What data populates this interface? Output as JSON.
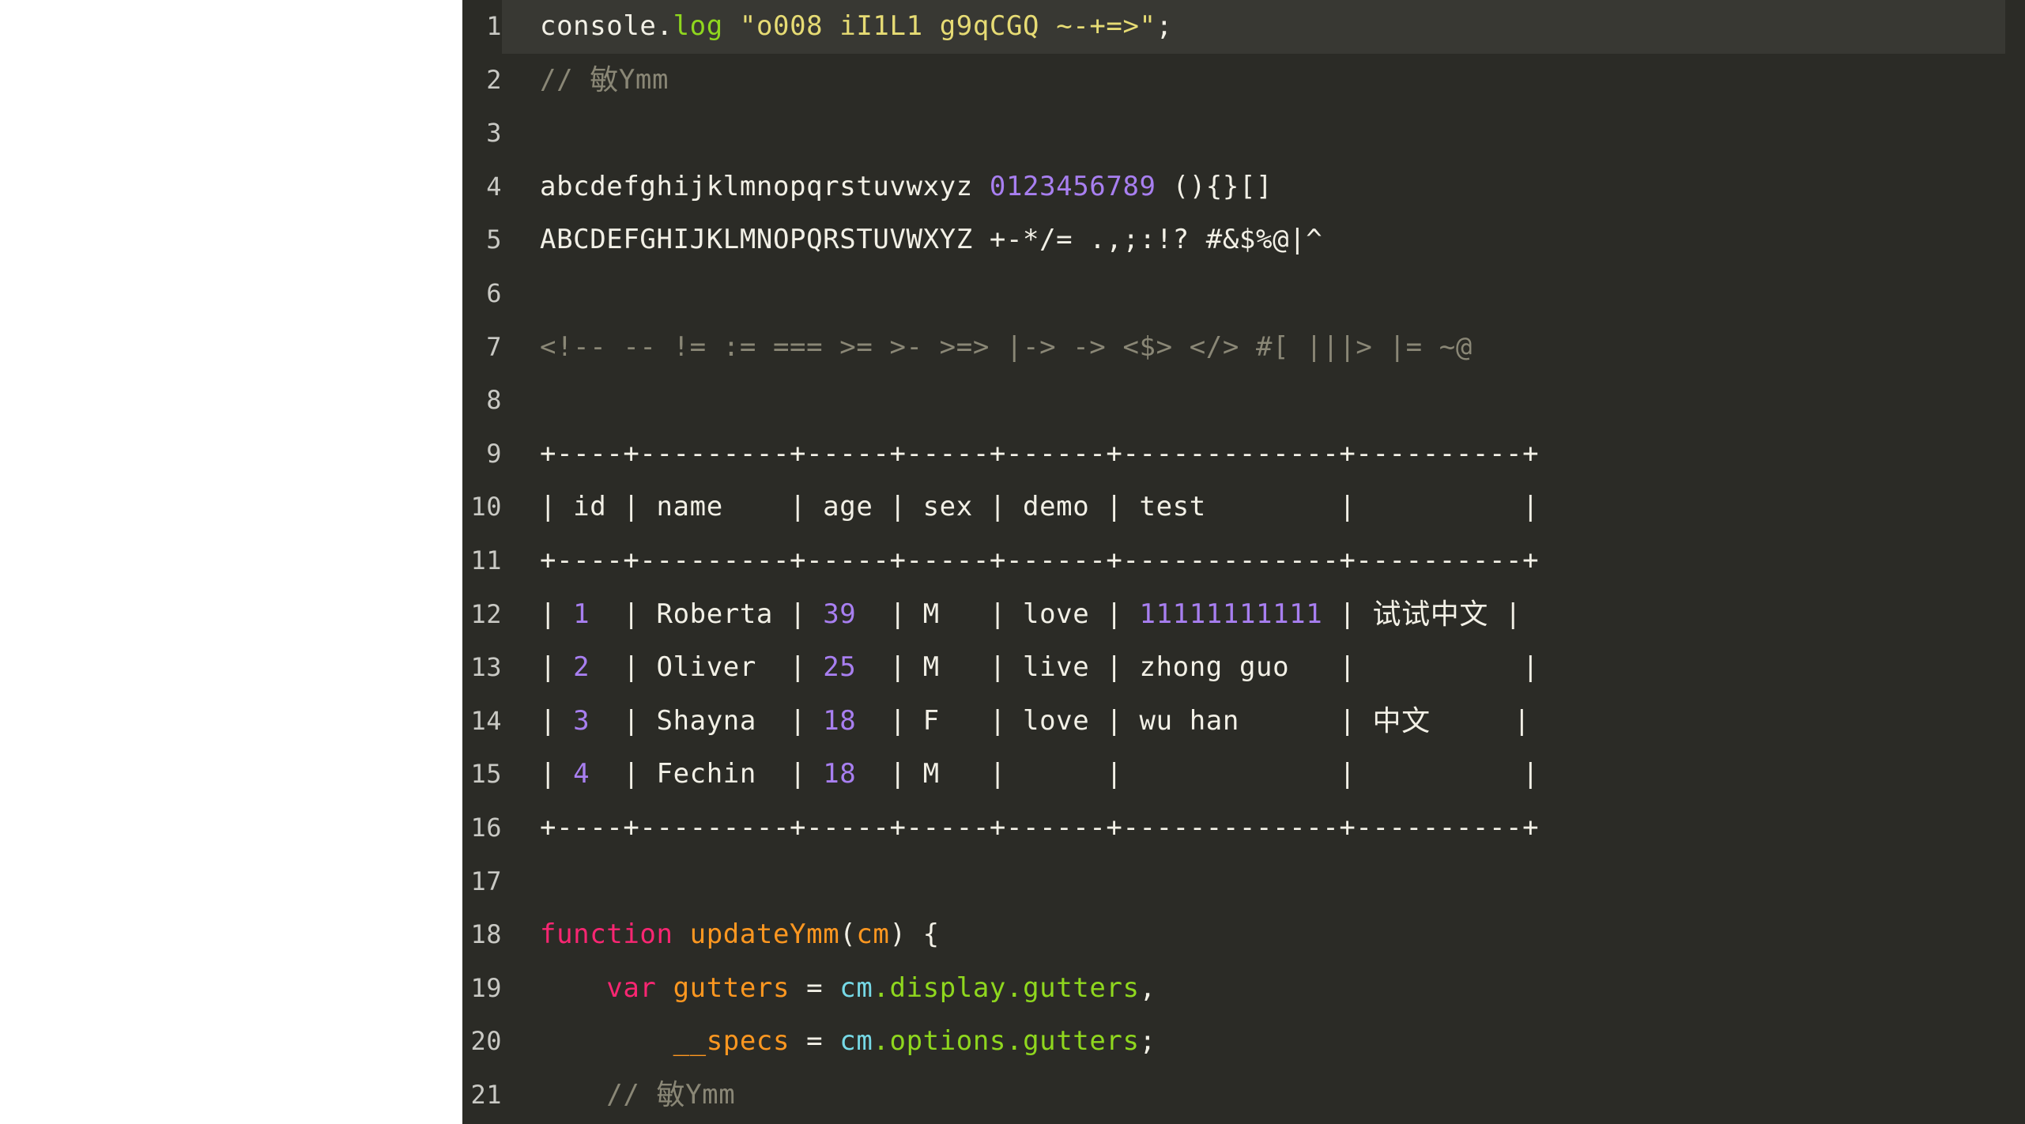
{
  "app": {
    "type": "code-editor-font-preview",
    "background_white": "#ffffff",
    "editor_background": "#2b2b26",
    "active_line_background": "#383833",
    "gutter_text_color": "#c9c9c4"
  },
  "palette": {
    "plain": "#f2f0e6",
    "keyword": "#f92672",
    "function": "#fd9720",
    "variable": "#fd9720",
    "string": "#e6db74",
    "number": "#a87ff0",
    "builtin": "#76d9e6",
    "property": "#8fd71e",
    "method": "#8fd71e",
    "comment": "#8a8776"
  },
  "editor": {
    "active_line": 1,
    "lines": [
      {
        "number": "1",
        "active": true,
        "tokens": [
          {
            "text": "console",
            "cls": "t-plain"
          },
          {
            "text": ".",
            "cls": "t-plain"
          },
          {
            "text": "log",
            "cls": "t-method"
          },
          {
            "text": " ",
            "cls": "t-plain"
          },
          {
            "text": "\"o008 iI1L1 g9qCGQ ~-+=>\"",
            "cls": "t-string"
          },
          {
            "text": ";",
            "cls": "t-plain"
          }
        ]
      },
      {
        "number": "2",
        "active": false,
        "tokens": [
          {
            "text": "// ",
            "cls": "t-comment"
          },
          {
            "text": "敏",
            "cls": "t-comment cjk-cmt"
          },
          {
            "text": "Ymm",
            "cls": "t-comment"
          }
        ]
      },
      {
        "number": "3",
        "active": false,
        "tokens": []
      },
      {
        "number": "4",
        "active": false,
        "tokens": [
          {
            "text": "abcdefghijklmnopqrstuvwxyz ",
            "cls": "t-plain"
          },
          {
            "text": "0123456789",
            "cls": "t-number"
          },
          {
            "text": " (){}[]",
            "cls": "t-plain"
          }
        ]
      },
      {
        "number": "5",
        "active": false,
        "tokens": [
          {
            "text": "ABCDEFGHIJKLMNOPQRSTUVWXYZ +-*/= .,;:!? #&$%@|^",
            "cls": "t-plain"
          }
        ]
      },
      {
        "number": "6",
        "active": false,
        "tokens": []
      },
      {
        "number": "7",
        "active": false,
        "tokens": [
          {
            "text": "<!-- -- != := === >= >- >=> |-> -> <$> </> #[ |||> |= ~@",
            "cls": "t-lig"
          }
        ]
      },
      {
        "number": "8",
        "active": false,
        "tokens": []
      },
      {
        "number": "9",
        "active": false,
        "tokens": [
          {
            "text": "+----+---------+-----+-----+------+-------------+----------+",
            "cls": "t-plain"
          }
        ]
      },
      {
        "number": "10",
        "active": false,
        "tokens": [
          {
            "text": "| id | name    | age | sex | demo | test        |          |",
            "cls": "t-plain"
          }
        ]
      },
      {
        "number": "11",
        "active": false,
        "tokens": [
          {
            "text": "+----+---------+-----+-----+------+-------------+----------+",
            "cls": "t-plain"
          }
        ]
      },
      {
        "number": "12",
        "active": false,
        "tokens": [
          {
            "text": "| ",
            "cls": "t-plain"
          },
          {
            "text": "1",
            "cls": "t-number"
          },
          {
            "text": "  | Roberta | ",
            "cls": "t-plain"
          },
          {
            "text": "39",
            "cls": "t-number"
          },
          {
            "text": "  | M   | love | ",
            "cls": "t-plain"
          },
          {
            "text": "11111111111",
            "cls": "t-number"
          },
          {
            "text": " | ",
            "cls": "t-plain"
          },
          {
            "text": "试试中文",
            "cls": "t-plain cjk"
          },
          {
            "text": " |",
            "cls": "t-plain"
          }
        ]
      },
      {
        "number": "13",
        "active": false,
        "tokens": [
          {
            "text": "| ",
            "cls": "t-plain"
          },
          {
            "text": "2",
            "cls": "t-number"
          },
          {
            "text": "  | Oliver  | ",
            "cls": "t-plain"
          },
          {
            "text": "25",
            "cls": "t-number"
          },
          {
            "text": "  | M   | live | zhong guo   |          |",
            "cls": "t-plain"
          }
        ]
      },
      {
        "number": "14",
        "active": false,
        "tokens": [
          {
            "text": "| ",
            "cls": "t-plain"
          },
          {
            "text": "3",
            "cls": "t-number"
          },
          {
            "text": "  | Shayna  | ",
            "cls": "t-plain"
          },
          {
            "text": "18",
            "cls": "t-number"
          },
          {
            "text": "  | F   | love | wu han      | ",
            "cls": "t-plain"
          },
          {
            "text": "中文",
            "cls": "t-plain cjk"
          },
          {
            "text": "     |",
            "cls": "t-plain"
          }
        ]
      },
      {
        "number": "15",
        "active": false,
        "tokens": [
          {
            "text": "| ",
            "cls": "t-plain"
          },
          {
            "text": "4",
            "cls": "t-number"
          },
          {
            "text": "  | Fechin  | ",
            "cls": "t-plain"
          },
          {
            "text": "18",
            "cls": "t-number"
          },
          {
            "text": "  | M   |      |             |          |",
            "cls": "t-plain"
          }
        ]
      },
      {
        "number": "16",
        "active": false,
        "tokens": [
          {
            "text": "+----+---------+-----+-----+------+-------------+----------+",
            "cls": "t-plain"
          }
        ]
      },
      {
        "number": "17",
        "active": false,
        "tokens": []
      },
      {
        "number": "18",
        "active": false,
        "tokens": [
          {
            "text": "function",
            "cls": "t-keyword"
          },
          {
            "text": " ",
            "cls": "t-plain"
          },
          {
            "text": "updateYmm",
            "cls": "t-func"
          },
          {
            "text": "(",
            "cls": "t-plain"
          },
          {
            "text": "cm",
            "cls": "t-func"
          },
          {
            "text": ") {",
            "cls": "t-plain"
          }
        ]
      },
      {
        "number": "19",
        "active": false,
        "tokens": [
          {
            "text": "    ",
            "cls": "t-plain"
          },
          {
            "text": "var",
            "cls": "t-keyword"
          },
          {
            "text": " ",
            "cls": "t-plain"
          },
          {
            "text": "gutters",
            "cls": "t-var"
          },
          {
            "text": " = ",
            "cls": "t-plain"
          },
          {
            "text": "cm",
            "cls": "t-builtin"
          },
          {
            "text": ".",
            "cls": "t-prop"
          },
          {
            "text": "display",
            "cls": "t-prop"
          },
          {
            "text": ".",
            "cls": "t-prop"
          },
          {
            "text": "gutters",
            "cls": "t-prop"
          },
          {
            "text": ",",
            "cls": "t-plain"
          }
        ]
      },
      {
        "number": "20",
        "active": false,
        "tokens": [
          {
            "text": "        ",
            "cls": "t-plain"
          },
          {
            "text": "__specs",
            "cls": "t-var"
          },
          {
            "text": " = ",
            "cls": "t-plain"
          },
          {
            "text": "cm",
            "cls": "t-builtin"
          },
          {
            "text": ".",
            "cls": "t-prop"
          },
          {
            "text": "options",
            "cls": "t-prop"
          },
          {
            "text": ".",
            "cls": "t-prop"
          },
          {
            "text": "gutters",
            "cls": "t-prop"
          },
          {
            "text": ";",
            "cls": "t-plain"
          }
        ]
      },
      {
        "number": "21",
        "active": false,
        "tokens": [
          {
            "text": "    // ",
            "cls": "t-comment"
          },
          {
            "text": "敏",
            "cls": "t-comment cjk-cmt"
          },
          {
            "text": "Ymm",
            "cls": "t-comment"
          }
        ]
      }
    ]
  }
}
